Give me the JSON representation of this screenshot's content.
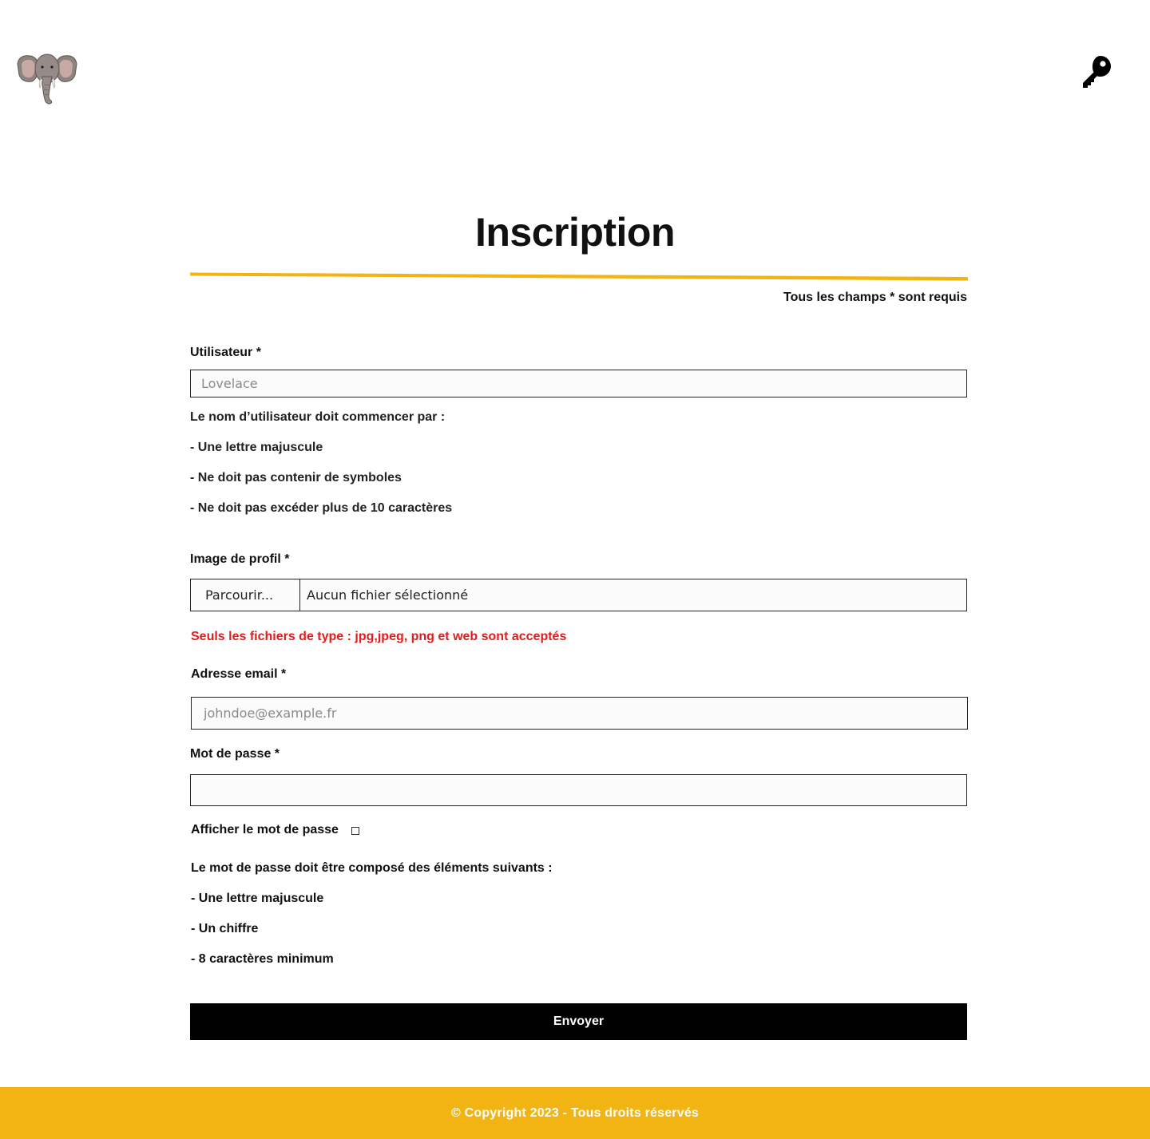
{
  "header": {
    "logo_icon": "elephant-head-logo",
    "login_icon": "key-icon"
  },
  "page": {
    "title": "Inscription",
    "required_note": "Tous les champs * sont requis",
    "accent_color": "#f2b413"
  },
  "form": {
    "username": {
      "label": "Utilisateur *",
      "placeholder": "Lovelace",
      "value": "",
      "rules_intro": "Le nom d’utilisateur doit commencer par :",
      "rules": [
        "- Une lettre majuscule",
        "- Ne doit pas contenir de symboles",
        "- Ne doit pas excéder plus de 10 caractères"
      ]
    },
    "profile_image": {
      "label": "Image de profil *",
      "browse_label": "Parcourir...",
      "status": "Aucun fichier sélectionné",
      "error": "Seuls les fichiers de type : jpg,jpeg, png et web sont acceptés",
      "error_color": "#e01c1c"
    },
    "email": {
      "label": "Adresse email *",
      "placeholder": "johndoe@example.fr",
      "value": ""
    },
    "password": {
      "label": "Mot de passe *",
      "value": "",
      "show_label": "Afficher le mot de passe",
      "show_checked": false,
      "rules_intro": "Le mot de passe doit être composé des éléments suivants :",
      "rules": [
        "- Une lettre majuscule",
        "- Un chiffre",
        "- 8 caractères minimum"
      ]
    },
    "submit_label": "Envoyer"
  },
  "footer": {
    "text": "© Copyright 2023 - Tous droits réservés"
  }
}
